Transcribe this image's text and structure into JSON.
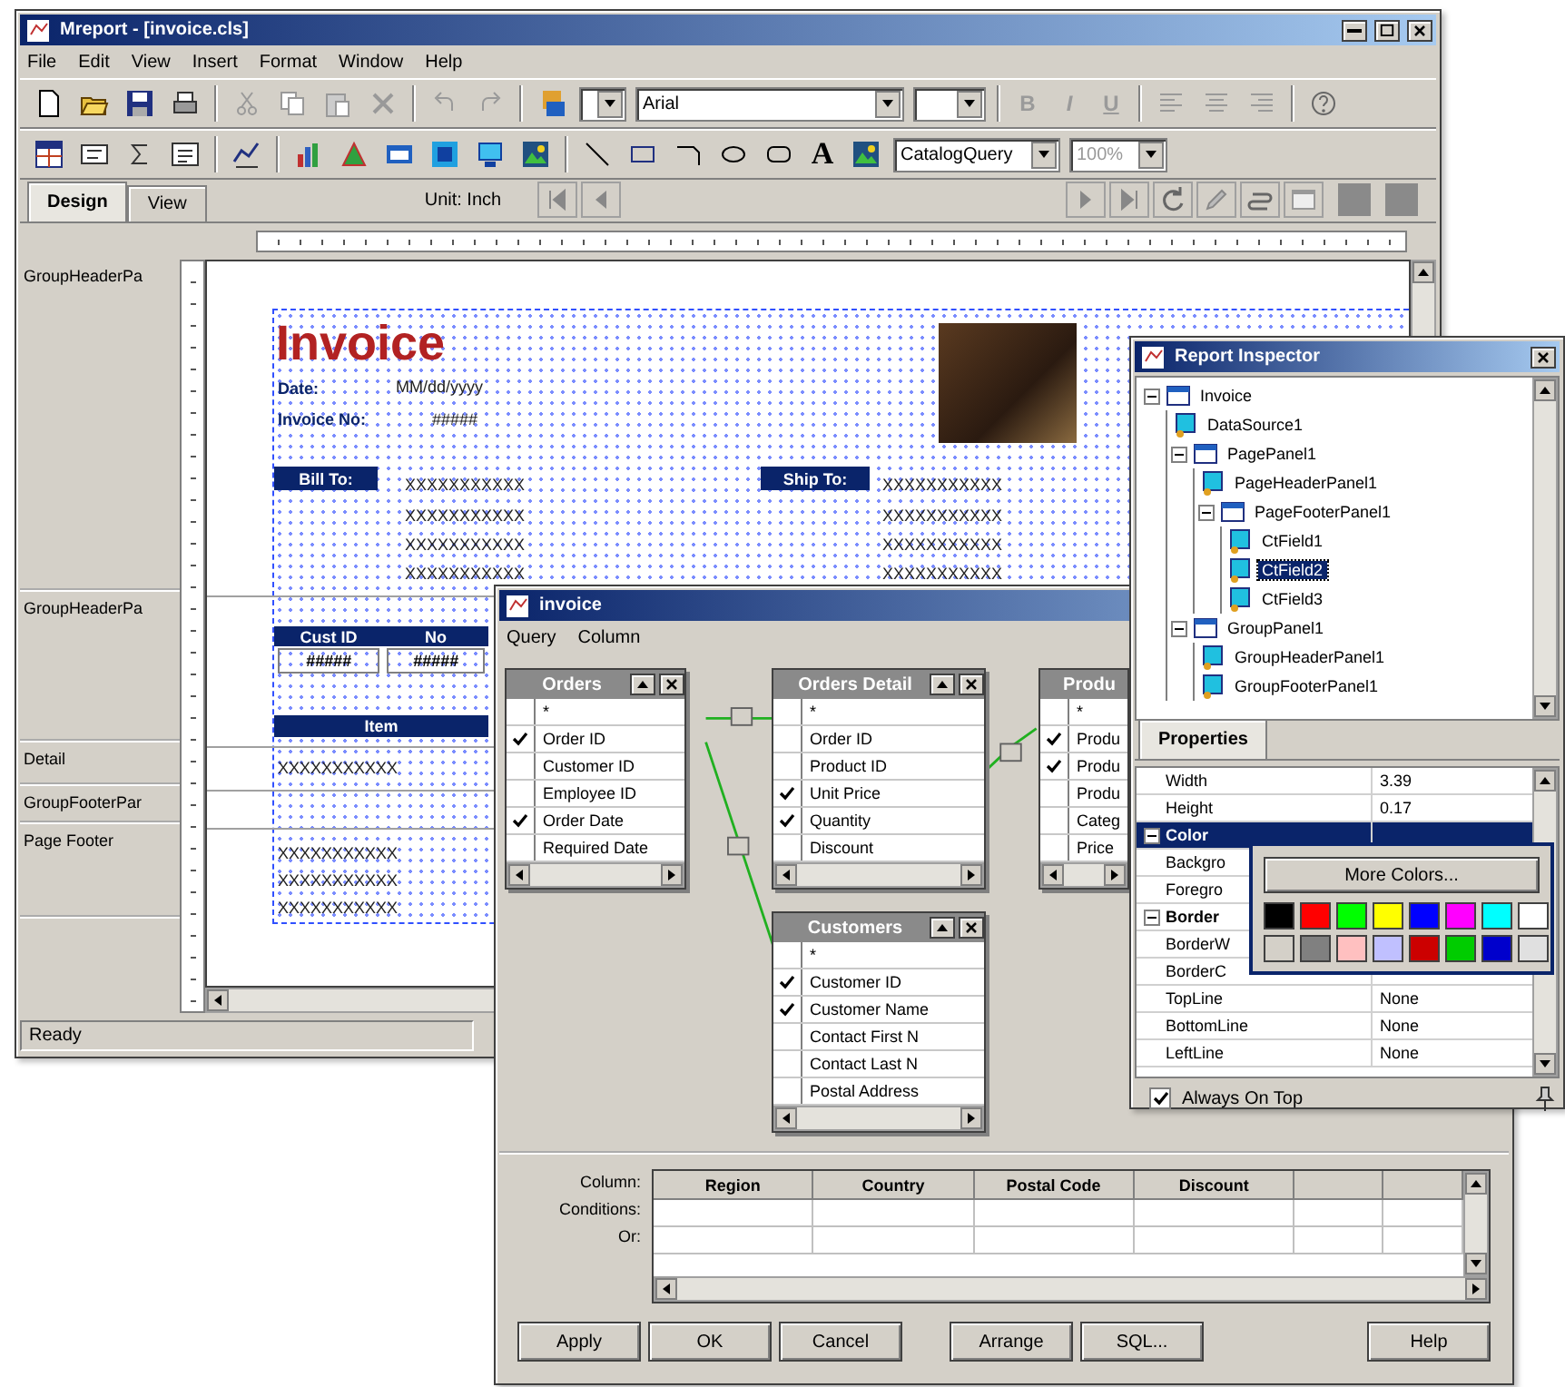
{
  "main_window": {
    "title": "Mreport - [invoice.cls]",
    "menu": [
      "File",
      "Edit",
      "View",
      "Insert",
      "Format",
      "Window",
      "Help"
    ],
    "font": "Arial",
    "format_buttons": [
      "B",
      "I",
      "U"
    ],
    "format_disabled": true,
    "text_tool": "A",
    "query": "CatalogQuery",
    "zoom": {
      "value": "100%",
      "disabled": true
    },
    "tabs": [
      {
        "label": "Design",
        "selected": true
      },
      {
        "label": "View",
        "selected": false
      }
    ],
    "unit": "Unit: Inch",
    "bands": [
      "GroupHeaderPa",
      "GroupHeaderPa",
      "Detail",
      "GroupFooterPar",
      "Page Footer"
    ],
    "report": {
      "title": "Invoice",
      "items": [
        {
          "kind": "label",
          "text": "Date:"
        },
        {
          "kind": "field",
          "text": "MM/dd/yyyy"
        },
        {
          "kind": "label",
          "text": "Invoice No:"
        },
        {
          "kind": "field",
          "text": "#####"
        },
        {
          "kind": "bar",
          "text": "Bill To:"
        },
        {
          "kind": "field",
          "text": "XXXXXXXXXXX"
        },
        {
          "kind": "field",
          "text": "XXXXXXXXXXX"
        },
        {
          "kind": "field",
          "text": "XXXXXXXXXXX"
        },
        {
          "kind": "field",
          "text": "XXXXXXXXXXX"
        },
        {
          "kind": "bar",
          "text": "Ship To:"
        },
        {
          "kind": "field",
          "text": "XXXXXXXXXXX"
        },
        {
          "kind": "field",
          "text": "XXXXXXXXXXX"
        },
        {
          "kind": "field",
          "text": "XXXXXXXXXXX"
        },
        {
          "kind": "field",
          "text": "XXXXXXXXXXX"
        },
        {
          "kind": "bar",
          "text": "Cust ID"
        },
        {
          "kind": "bar",
          "text": "No"
        },
        {
          "kind": "box",
          "text": "#####"
        },
        {
          "kind": "box",
          "text": "#####"
        },
        {
          "kind": "bar",
          "text": "Item"
        },
        {
          "kind": "field",
          "text": "XXXXXXXXXXX"
        },
        {
          "kind": "field",
          "text": "XXXXXXXXXXX"
        },
        {
          "kind": "field",
          "text": "XXXXXXXXXXX"
        },
        {
          "kind": "field",
          "text": "XXXXXXXXXXX"
        }
      ]
    },
    "status": "Ready"
  },
  "query_dialog": {
    "title": "invoice",
    "menu": [
      "Query",
      "Column"
    ],
    "tables": [
      {
        "name": "Orders",
        "fields": [
          {
            "label": "*",
            "checked": false
          },
          {
            "label": "Order ID",
            "checked": true
          },
          {
            "label": "Customer ID",
            "checked": false
          },
          {
            "label": "Employee ID",
            "checked": false
          },
          {
            "label": "Order Date",
            "checked": true
          },
          {
            "label": "Required Date",
            "checked": false
          }
        ]
      },
      {
        "name": "Orders Detail",
        "fields": [
          {
            "label": "*",
            "checked": false
          },
          {
            "label": "Order ID",
            "checked": false
          },
          {
            "label": "Product ID",
            "checked": false
          },
          {
            "label": "Unit Price",
            "checked": true
          },
          {
            "label": "Quantity",
            "checked": true
          },
          {
            "label": "Discount",
            "checked": false
          }
        ]
      },
      {
        "name": "Produ",
        "fields": [
          {
            "label": "*",
            "checked": false
          },
          {
            "label": "Produ",
            "checked": true
          },
          {
            "label": "Produ",
            "checked": true
          },
          {
            "label": "Produ",
            "checked": false
          },
          {
            "label": "Categ",
            "checked": false
          },
          {
            "label": "Price",
            "checked": false
          }
        ]
      },
      {
        "name": "Customers",
        "fields": [
          {
            "label": "*",
            "checked": false
          },
          {
            "label": "Customer ID",
            "checked": true
          },
          {
            "label": "Customer Name",
            "checked": true
          },
          {
            "label": "Contact First N",
            "checked": false
          },
          {
            "label": "Contact Last N",
            "checked": false
          },
          {
            "label": "Postal Address",
            "checked": false
          }
        ]
      }
    ],
    "grid": {
      "row_labels": [
        "Column:",
        "Conditions:",
        "Or:"
      ],
      "columns": [
        "Region",
        "Country",
        "Postal Code",
        "Discount"
      ]
    },
    "buttons": [
      "Apply",
      "OK",
      "Cancel",
      "Arrange",
      "SQL...",
      "Help"
    ]
  },
  "inspector": {
    "title": "Report Inspector",
    "tree": [
      {
        "label": "Invoice",
        "expanded": true,
        "selected": false,
        "children": [
          {
            "label": "DataSource1",
            "selected": false
          },
          {
            "label": "PagePanel1",
            "expanded": true,
            "selected": false,
            "children": [
              {
                "label": "PageHeaderPanel1",
                "selected": false
              },
              {
                "label": "PageFooterPanel1",
                "expanded": true,
                "selected": false,
                "children": [
                  {
                    "label": "CtField1",
                    "selected": false
                  },
                  {
                    "label": "CtField2",
                    "selected": true
                  },
                  {
                    "label": "CtField3",
                    "selected": false
                  }
                ]
              }
            ]
          },
          {
            "label": "GroupPanel1",
            "expanded": true,
            "selected": false,
            "children": [
              {
                "label": "GroupHeaderPanel1",
                "selected": false
              },
              {
                "label": "GroupFooterPanel1",
                "selected": false
              }
            ]
          }
        ]
      }
    ],
    "tab": "Properties",
    "properties": [
      {
        "kind": "prop",
        "name": "Width",
        "value": "3.39",
        "selected": false
      },
      {
        "kind": "prop",
        "name": "Height",
        "value": "0.17",
        "selected": false
      },
      {
        "kind": "group",
        "name": "Color",
        "expanded": true,
        "selected": true
      },
      {
        "kind": "prop",
        "name": "Backgro",
        "selected": false
      },
      {
        "kind": "prop",
        "name": "Foregro",
        "selected": false
      },
      {
        "kind": "group",
        "name": "Border",
        "expanded": true,
        "selected": false
      },
      {
        "kind": "prop",
        "name": "BorderW",
        "selected": false
      },
      {
        "kind": "prop",
        "name": "BorderC",
        "selected": false
      },
      {
        "kind": "prop",
        "name": "TopLine",
        "value": "None",
        "selected": false
      },
      {
        "kind": "prop",
        "name": "BottomLine",
        "value": "None",
        "selected": false
      },
      {
        "kind": "prop",
        "name": "LeftLine",
        "value": "None",
        "selected": false
      }
    ],
    "color_popup": {
      "button": "More Colors...",
      "swatches": [
        {
          "color": "#000000"
        },
        {
          "color": "#ff0000"
        },
        {
          "color": "#00ff00"
        },
        {
          "color": "#ffff00"
        },
        {
          "color": "#0000ff"
        },
        {
          "color": "#ff00ff"
        },
        {
          "color": "#00ffff"
        },
        {
          "color": "#ffffff"
        },
        {
          "color": "#d4d0c8"
        },
        {
          "color": "#808080"
        },
        {
          "color": "#ffc0c0"
        },
        {
          "color": "#c0c0ff"
        },
        {
          "color": "#cc0000"
        },
        {
          "color": "#00cc00"
        },
        {
          "color": "#0000cc"
        },
        {
          "color": "#e0e0e0"
        }
      ]
    },
    "always_on_top": {
      "label": "Always On Top",
      "checked": true
    }
  }
}
